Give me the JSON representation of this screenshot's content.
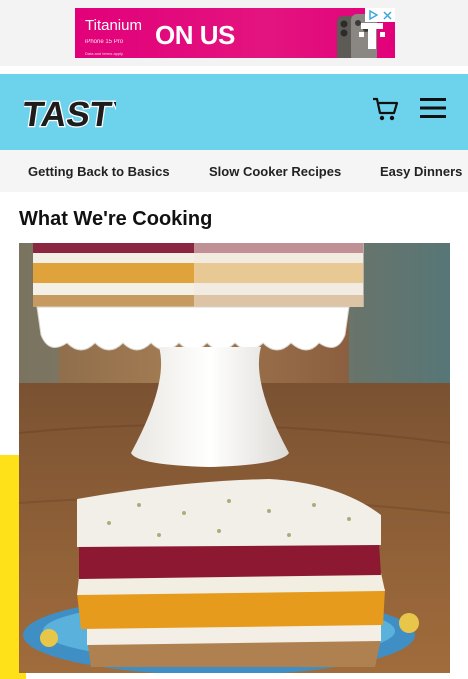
{
  "ad": {
    "line1": "Titanium",
    "line2": "iPhone 15 Pro",
    "line3": "Data and terms apply",
    "headline": "ON US",
    "brand_letter": "T",
    "colors": {
      "brand": "#e2007a"
    }
  },
  "header": {
    "logo_text": "TASTY",
    "icons": [
      "cart-icon",
      "hamburger-menu-icon"
    ],
    "colors": {
      "background": "#6dd3ec"
    }
  },
  "nav": {
    "items": [
      "Getting Back to Basics",
      "Slow Cooker Recipes",
      "Easy Dinners"
    ]
  },
  "main": {
    "section_title": "What We're Cooking",
    "hero_alt": "layered cheesecake on cake stand"
  }
}
